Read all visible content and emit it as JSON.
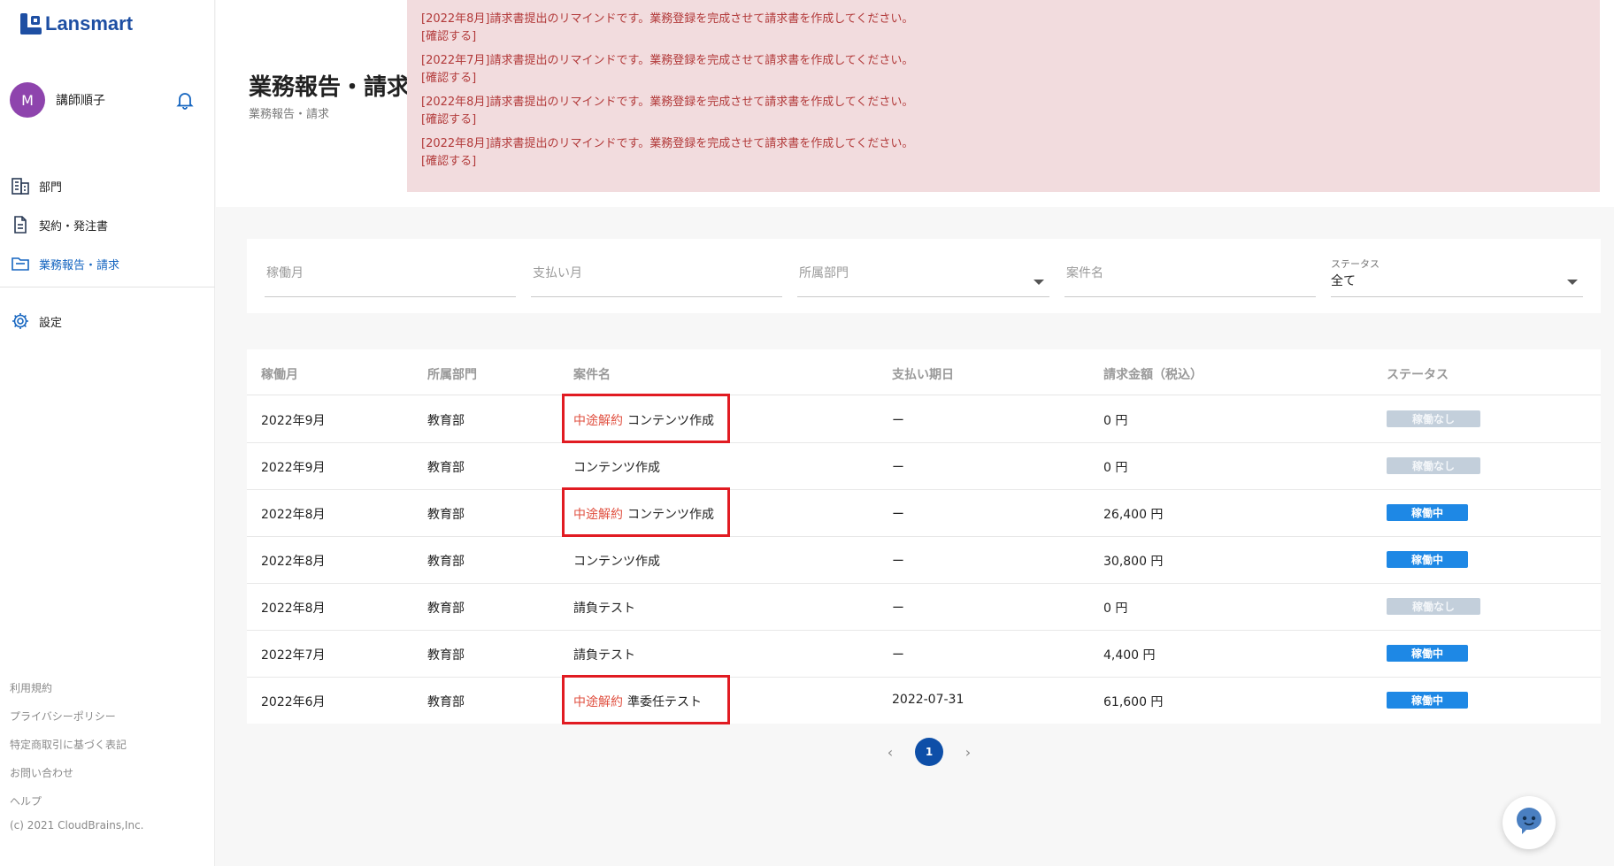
{
  "app": {
    "logo_text": "Lansmart"
  },
  "user": {
    "avatar_initial": "M",
    "name": "講師順子"
  },
  "nav": {
    "items": [
      {
        "label": "部門",
        "icon": "building-icon"
      },
      {
        "label": "契約・発注書",
        "icon": "document-icon"
      },
      {
        "label": "業務報告・請求",
        "icon": "folder-icon",
        "active": true
      }
    ],
    "settings_label": "設定"
  },
  "footer": {
    "links": [
      "利用規約",
      "プライバシーポリシー",
      "特定商取引に基づく表記",
      "お問い合わせ",
      "ヘルプ"
    ],
    "copyright": "(c) 2021 CloudBrains,Inc."
  },
  "header": {
    "title": "業務報告・請求",
    "breadcrumb": "業務報告・請求",
    "notices": [
      {
        "message": "[2022年8月]請求書提出のリマインドです。業務登録を完成させて請求書を作成してください。",
        "action": "[確認する]"
      },
      {
        "message": "[2022年7月]請求書提出のリマインドです。業務登録を完成させて請求書を作成してください。",
        "action": "[確認する]"
      },
      {
        "message": "[2022年8月]請求書提出のリマインドです。業務登録を完成させて請求書を作成してください。",
        "action": "[確認する]"
      },
      {
        "message": "[2022年8月]請求書提出のリマインドです。業務登録を完成させて請求書を作成してください。",
        "action": "[確認する]"
      }
    ]
  },
  "filters": {
    "work_month": {
      "placeholder": "稼働月"
    },
    "pay_month": {
      "placeholder": "支払い月"
    },
    "department": {
      "placeholder": "所属部門"
    },
    "project": {
      "placeholder": "案件名"
    },
    "status": {
      "label": "ステータス",
      "value": "全て"
    }
  },
  "table": {
    "headers": [
      "稼働月",
      "所属部門",
      "案件名",
      "支払い期日",
      "請求金額（税込）",
      "ステータス"
    ],
    "rows": [
      {
        "month": "2022年9月",
        "dept": "教育部",
        "tag": "中途解約",
        "project": "コンテンツ作成",
        "due": "ー",
        "amount": "0 円",
        "status": "稼働なし",
        "status_type": "inactive"
      },
      {
        "month": "2022年9月",
        "dept": "教育部",
        "tag": "",
        "project": "コンテンツ作成",
        "due": "ー",
        "amount": "0 円",
        "status": "稼働なし",
        "status_type": "inactive"
      },
      {
        "month": "2022年8月",
        "dept": "教育部",
        "tag": "中途解約",
        "project": "コンテンツ作成",
        "due": "ー",
        "amount": "26,400 円",
        "status": "稼働中",
        "status_type": "active"
      },
      {
        "month": "2022年8月",
        "dept": "教育部",
        "tag": "",
        "project": "コンテンツ作成",
        "due": "ー",
        "amount": "30,800 円",
        "status": "稼働中",
        "status_type": "active"
      },
      {
        "month": "2022年8月",
        "dept": "教育部",
        "tag": "",
        "project": "請負テスト",
        "due": "ー",
        "amount": "0 円",
        "status": "稼働なし",
        "status_type": "inactive"
      },
      {
        "month": "2022年7月",
        "dept": "教育部",
        "tag": "",
        "project": "請負テスト",
        "due": "ー",
        "amount": "4,400 円",
        "status": "稼働中",
        "status_type": "active"
      },
      {
        "month": "2022年6月",
        "dept": "教育部",
        "tag": "中途解約",
        "project": "準委任テスト",
        "due": "2022-07-31",
        "amount": "61,600 円",
        "status": "稼働中",
        "status_type": "active"
      }
    ]
  },
  "pagination": {
    "prev": "‹",
    "current": "1",
    "next": "›"
  },
  "colors": {
    "brand": "#1e4fa3",
    "notice_bg": "#f2dcde",
    "notice_text": "#b23a3a",
    "status_active": "#1e88e5",
    "status_inactive": "#c3cfdb",
    "cancel_tag": "#e05040",
    "highlight": "#e11b22"
  }
}
